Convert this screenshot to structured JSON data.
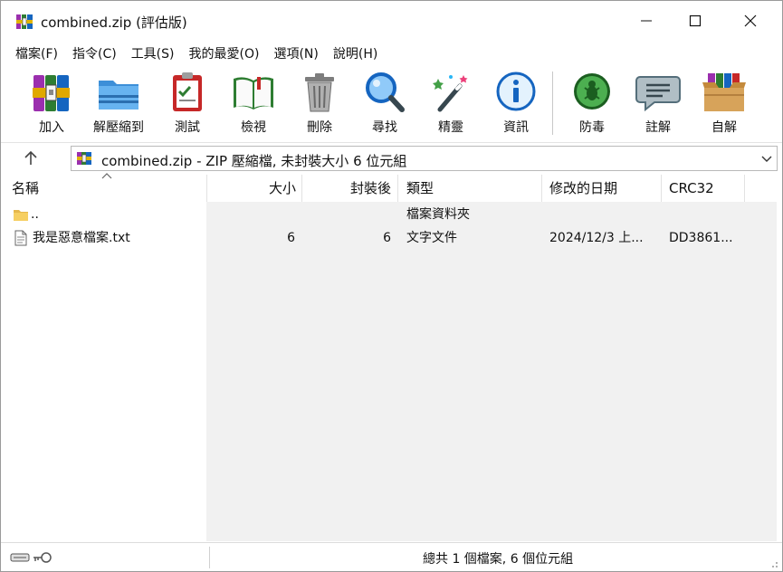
{
  "window": {
    "title": "combined.zip (評估版)"
  },
  "menu": {
    "items": [
      "檔案(F)",
      "指令(C)",
      "工具(S)",
      "我的最愛(O)",
      "選項(N)",
      "說明(H)"
    ]
  },
  "toolbar": {
    "buttons": [
      {
        "label": "加入",
        "icon": "add-archive-icon"
      },
      {
        "label": "解壓縮到",
        "icon": "extract-to-icon"
      },
      {
        "label": "測試",
        "icon": "test-icon"
      },
      {
        "label": "檢視",
        "icon": "view-book-icon"
      },
      {
        "label": "刪除",
        "icon": "trash-icon"
      },
      {
        "label": "尋找",
        "icon": "magnifier-icon"
      },
      {
        "label": "精靈",
        "icon": "wizard-wand-icon"
      },
      {
        "label": "資訊",
        "icon": "info-icon"
      },
      {
        "label": "防毒",
        "icon": "virus-scan-icon"
      },
      {
        "label": "註解",
        "icon": "comment-icon"
      },
      {
        "label": "自解",
        "icon": "sfx-box-icon"
      }
    ]
  },
  "address": {
    "path": "combined.zip - ZIP 壓縮檔, 未封裝大小 6 位元組"
  },
  "columns": {
    "name": "名稱",
    "size": "大小",
    "packed": "封裝後",
    "type": "類型",
    "modified": "修改的日期",
    "crc": "CRC32"
  },
  "files": [
    {
      "name": "..",
      "size": "",
      "packed": "",
      "type": "檔案資料夾",
      "modified": "",
      "crc": "",
      "icon": "folder-icon"
    },
    {
      "name": "我是惡意檔案.txt",
      "size": "6",
      "packed": "6",
      "type": "文字文件",
      "modified": "2024/12/3 上...",
      "crc": "DD3861...",
      "icon": "text-file-icon"
    }
  ],
  "status": {
    "summary": "總共 1 個檔案, 6 個位元組"
  },
  "colors": {
    "window_border": "#9a9a9a",
    "list_shade": "#f1f1f1",
    "header_separator": "#e2e2e2"
  }
}
